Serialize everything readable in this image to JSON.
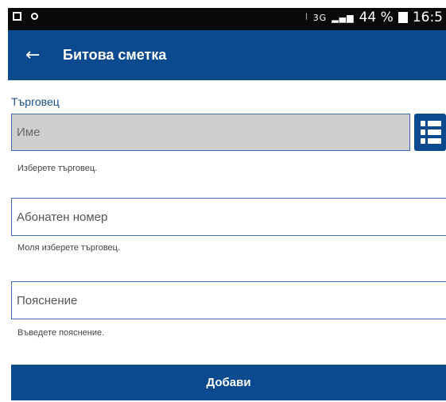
{
  "status_bar": {
    "network": "3G",
    "battery": "44 %",
    "time": "16:5"
  },
  "app_bar": {
    "back_icon": "arrow-left-icon",
    "title": "Битова сметка"
  },
  "form": {
    "merchant_label": "Търговец",
    "merchant_input": {
      "placeholder": "Име",
      "value": ""
    },
    "merchant_list_icon": "list-icon",
    "merchant_help": "Изберете търговец.",
    "subscriber_input": {
      "placeholder": "Абонатен номер",
      "value": ""
    },
    "subscriber_help": "Моля изберете търговец.",
    "note_input": {
      "placeholder": "Пояснение",
      "value": ""
    },
    "note_help": "Въведете пояснение.",
    "submit_label": "Добави"
  },
  "colors": {
    "primary": "#0b4a8f",
    "field_border": "#3f6db5",
    "disabled_field": "#cfcfcf"
  }
}
